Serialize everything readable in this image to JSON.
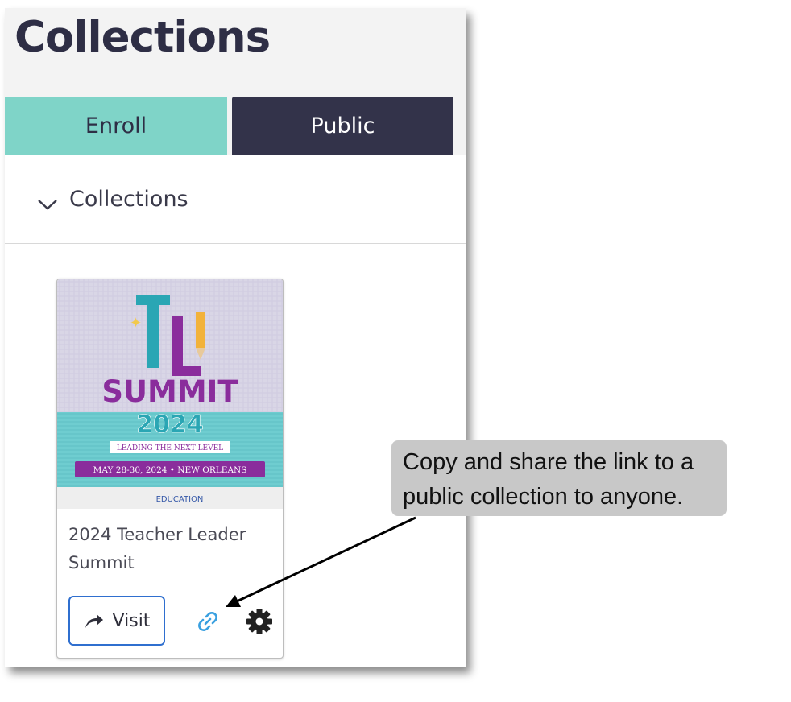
{
  "header": {
    "title": "Collections",
    "tabs": [
      {
        "label": "Enroll",
        "active": false
      },
      {
        "label": "Public",
        "active": true
      }
    ]
  },
  "section": {
    "label": "Collections",
    "expanded": true
  },
  "card": {
    "title": "2024 Teacher Leader Summit",
    "visit_label": "Visit",
    "image": {
      "logo_letters": "TL",
      "headline": "SUMMIT",
      "year": "2024",
      "tagline": "LEADING THE NEXT LEVEL",
      "date_location": "MAY 28-30, 2024 • NEW ORLEANS",
      "org": "EDUCATION"
    }
  },
  "annotation": {
    "text": "Copy and share the link to a public collection to anyone."
  },
  "colors": {
    "enroll_tab": "#7fd4c8",
    "public_tab": "#33334a",
    "visit_border": "#2f6fcf",
    "link_icon": "#3aa0e0"
  }
}
